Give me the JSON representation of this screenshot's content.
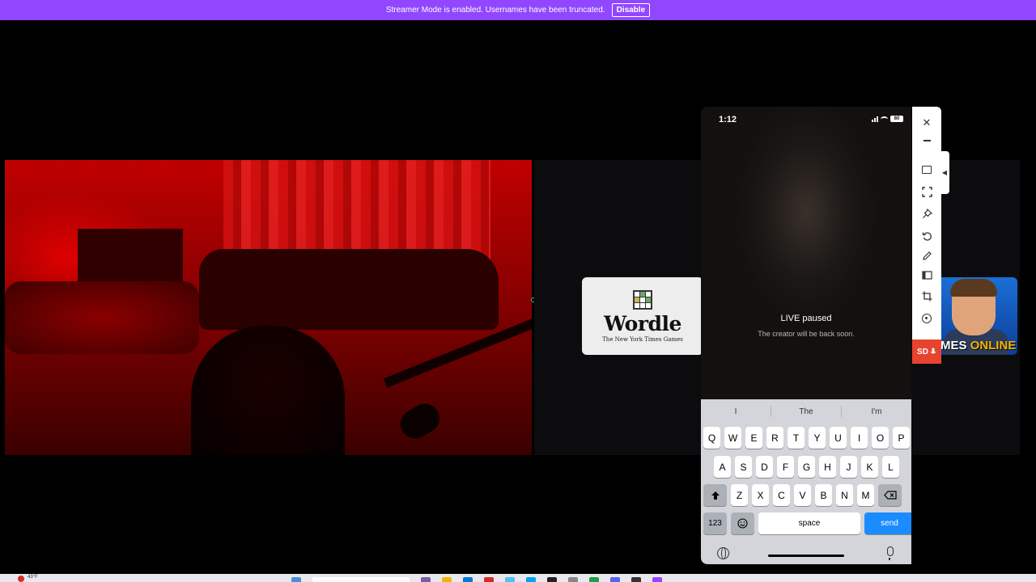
{
  "banner": {
    "message": "Streamer Mode is enabled. Usernames have been truncated.",
    "button_label": "Disable",
    "color": "#9147ff"
  },
  "cards": {
    "wordle": {
      "title": "Wordle",
      "subtitle": "The New York Times Games"
    },
    "games": {
      "label_white": "MES",
      "label_orange": "ONLINE"
    }
  },
  "phone": {
    "status_time": "1:12",
    "battery": "80",
    "live_title": "LIVE paused",
    "live_subtitle": "The creator will be back soon.",
    "keyboard": {
      "suggestions": [
        "I",
        "The",
        "I'm"
      ],
      "row1": [
        "Q",
        "W",
        "E",
        "R",
        "T",
        "Y",
        "U",
        "I",
        "O",
        "P"
      ],
      "row2": [
        "A",
        "S",
        "D",
        "F",
        "G",
        "H",
        "J",
        "K",
        "L"
      ],
      "row3": [
        "Z",
        "X",
        "C",
        "V",
        "B",
        "N",
        "M"
      ],
      "numbers_label": "123",
      "space_label": "space",
      "send_label": "send",
      "send_color": "#1a8cff"
    }
  },
  "toolbar": {
    "close": "✕",
    "icons": [
      "minimize-icon",
      "screenshot-icon",
      "fullscreen-icon",
      "pin-icon",
      "rotate-icon",
      "pen-icon",
      "split-icon",
      "crop-icon",
      "record-icon"
    ],
    "sd_label": "SD"
  },
  "taskbar": {
    "temperature": "43°F"
  }
}
